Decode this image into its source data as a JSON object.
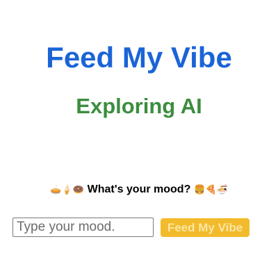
{
  "header": {
    "title": "Feed My Vibe",
    "subtitle": "Exploring AI"
  },
  "mood_prompt": {
    "leading_emojis": [
      "🥧",
      "🍦",
      "🍩"
    ],
    "text": "What's your mood?",
    "trailing_emojis": [
      "🍔",
      "🍕",
      "🍜"
    ]
  },
  "form": {
    "input_placeholder": "Type your mood.",
    "input_value": "",
    "button_label": "Feed My Vibe"
  },
  "colors": {
    "title": "#1b64d6",
    "subtitle": "#3c8d3f",
    "button_background": "#f2bb2b",
    "button_text": "#fbe6a4"
  }
}
